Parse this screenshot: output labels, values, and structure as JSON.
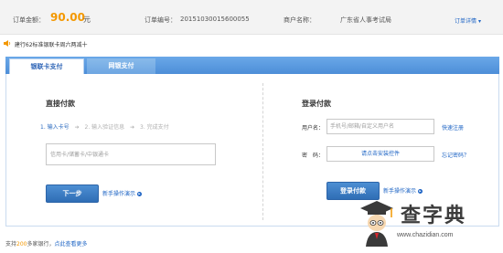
{
  "order": {
    "amount_label": "订单金额：",
    "amount_value": "90.00",
    "amount_unit": "元",
    "number_label": "订单编号：",
    "number_value": "20151030015600055",
    "merchant_label": "商户名称：",
    "merchant_value": "广东省人事考试局",
    "detail_link": "订单详情",
    "amount_color": "#f39800"
  },
  "notice": {
    "text": "建行62标准银联卡周六两减十",
    "icon": "speaker-icon"
  },
  "tabs": [
    {
      "label": "银联卡支付",
      "active": true
    },
    {
      "label": "网银支付",
      "active": false
    }
  ],
  "direct_pay": {
    "title": "直接付款",
    "steps": [
      "1. 输入卡号",
      "2. 输入验证信息",
      "3. 完成支付"
    ],
    "card_placeholder": "信用卡/储蓄卡/中银通卡",
    "next_button": "下一步",
    "guide_link": "新手操作演示"
  },
  "login_pay": {
    "title": "登录付款",
    "username_label": "用户名：",
    "username_placeholder": "手机号/邮箱/自定义用户名",
    "register_link": "快速注册",
    "password_label": "密　码：",
    "password_prompt": "请点击安装控件",
    "forgot_link": "忘记密码？",
    "login_button": "登录付款",
    "guide_link": "新手操作演示"
  },
  "footer": {
    "prefix": "支持",
    "count": "200",
    "suffix": "多家银行，",
    "link": "点此查看更多"
  },
  "watermark": {
    "text": "查字典",
    "url": "www.chazidian.com"
  },
  "colors": {
    "accent_blue": "#2f6db5",
    "link_blue": "#1c63c4",
    "orange": "#f39800"
  }
}
